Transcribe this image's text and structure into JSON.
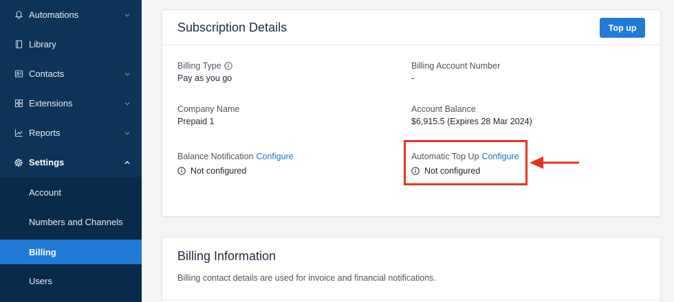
{
  "sidebar": {
    "items": [
      {
        "label": "Automations",
        "icon": "bell-icon",
        "chevron": "down"
      },
      {
        "label": "Library",
        "icon": "document-icon"
      },
      {
        "label": "Contacts",
        "icon": "contacts-icon",
        "chevron": "down"
      },
      {
        "label": "Extensions",
        "icon": "grid-icon",
        "chevron": "down"
      },
      {
        "label": "Reports",
        "icon": "chart-icon",
        "chevron": "down"
      },
      {
        "label": "Settings",
        "icon": "gear-icon",
        "chevron": "up"
      }
    ],
    "subitems": [
      {
        "label": "Account"
      },
      {
        "label": "Numbers and Channels"
      },
      {
        "label": "Billing",
        "active": true
      },
      {
        "label": "Users"
      }
    ]
  },
  "subscription": {
    "title": "Subscription Details",
    "topup_label": "Top up",
    "billing_type_label": "Billing Type",
    "billing_type_value": "Pay as you go",
    "account_number_label": "Billing Account Number",
    "account_number_value": "-",
    "company_name_label": "Company Name",
    "company_name_value": "Prepaid 1",
    "balance_label": "Account Balance",
    "balance_value": "$6,915.5 (Expires 28 Mar 2024)",
    "balance_notification_label": "Balance Notification",
    "balance_notification_link": "Configure",
    "balance_notification_status": "Not configured",
    "auto_topup_label": "Automatic Top Up",
    "auto_topup_link": "Configure",
    "auto_topup_status": "Not configured"
  },
  "billing_info": {
    "title": "Billing Information",
    "description": "Billing contact details are used for invoice and financial notifications."
  },
  "colors": {
    "sidebar_bg": "#0e3358",
    "active_bg": "#1f7bd6",
    "link": "#1f6fc5",
    "highlight": "#e8321f"
  }
}
